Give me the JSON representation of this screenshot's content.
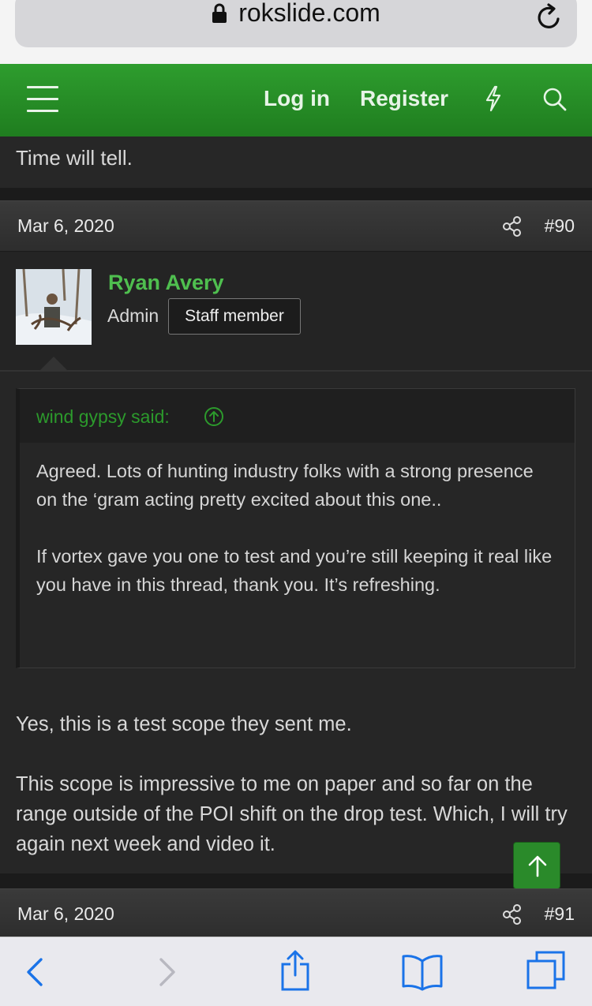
{
  "browser": {
    "url": "rokslide.com",
    "lock_icon": "lock-icon",
    "reload_icon": "reload-icon"
  },
  "nav": {
    "menu_icon": "hamburger-menu-icon",
    "login_label": "Log in",
    "register_label": "Register",
    "whats_new_icon": "lightning-bolt-icon",
    "search_icon": "search-icon",
    "color": "#2a932a"
  },
  "previous_post": {
    "text": "Time will tell."
  },
  "post_90": {
    "date": "Mar 6, 2020",
    "number": "#90",
    "author": {
      "name": "Ryan Avery",
      "role": "Admin",
      "badge": "Staff member"
    },
    "quote": {
      "author_line": "wind gypsy said:",
      "paragraphs": [
        "Agreed. Lots of hunting industry folks with a strong presence on the ‘gram acting pretty excited about this one..",
        "If vortex gave you one to test and you’re still keeping it real like you have in this thread, thank you. It’s refreshing."
      ]
    },
    "body": [
      "Yes, this is a test scope they sent me.",
      "This scope is impressive to me on paper and so far on the range outside of the POI shift on the drop test. Which, I will try again next week and video it."
    ]
  },
  "post_91": {
    "date": "Mar 6, 2020",
    "number": "#91"
  },
  "toolbar": {
    "back_icon": "back-chevron-icon",
    "forward_icon": "forward-chevron-icon",
    "share_icon": "share-icon",
    "bookmarks_icon": "bookmarks-icon",
    "tabs_icon": "tabs-icon"
  }
}
